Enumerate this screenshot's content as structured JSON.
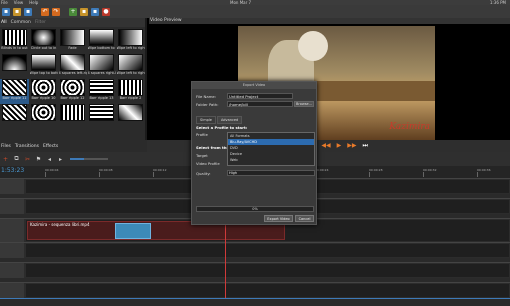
{
  "menu": {
    "file": "File",
    "view": "View",
    "help": "Help"
  },
  "clock": "Mon Mar 7",
  "tray": [
    "1:36 PM"
  ],
  "left_panel": {
    "tabs": [
      "All",
      "Common",
      "Filter"
    ],
    "items": [
      {
        "label": "Blinds in to out"
      },
      {
        "label": "Circle out to in"
      },
      {
        "label": "Fade"
      },
      {
        "label": "Wipe bottom to top"
      },
      {
        "label": "Wipe left to right"
      },
      {
        "label": ""
      },
      {
        "label": "Wipe top to bottom"
      },
      {
        "label": "4 squares left-right"
      },
      {
        "label": "4 squares right-left"
      },
      {
        "label": "Wipe left to right"
      },
      {
        "label": "Barr ripple 11"
      },
      {
        "label": "Barr ripple 10"
      },
      {
        "label": "Barr ripple 12"
      },
      {
        "label": "Barr ripple 13"
      },
      {
        "label": "Barr ripple 2"
      },
      {
        "label": ""
      },
      {
        "label": ""
      },
      {
        "label": ""
      },
      {
        "label": ""
      },
      {
        "label": ""
      }
    ]
  },
  "preview": {
    "title": "Video Preview",
    "logo": "Kazimira"
  },
  "lower_tabs": [
    "Files",
    "Transitions",
    "Effects"
  ],
  "timeline": {
    "time": "1:53:23",
    "ticks": [
      "00:00:04",
      "00:00:08",
      "00:00:12",
      "00:00:16",
      "00:00:20",
      "00:00:24",
      "00:00:28",
      "00:00:32",
      "00:00:36",
      "00:00:40",
      "00:00:44"
    ],
    "clip_name": "Kazimira - sequenza libri.mp4"
  },
  "dialog": {
    "title": "Export Video",
    "file_name_label": "File Name:",
    "file_name": "Untitled Project",
    "folder_label": "Folder Path:",
    "folder": "/home/bill",
    "browse": "Browse...",
    "tabs": [
      "Simple",
      "Advanced"
    ],
    "profile_section": "Select a Profile to start:",
    "profile_label": "Profile",
    "profile_options": [
      "All Formats",
      "Blu-Ray/AVCHD",
      "DVD",
      "Device",
      "Web"
    ],
    "profile_selected": "Blu-Ray/AVCHD",
    "select_from": "Select from the",
    "target_label": "Target",
    "video_profile_label": "Video Profile",
    "quality_label": "Quality:",
    "quality": "High",
    "progress": "0%",
    "export": "Export Video",
    "cancel": "Cancel"
  }
}
